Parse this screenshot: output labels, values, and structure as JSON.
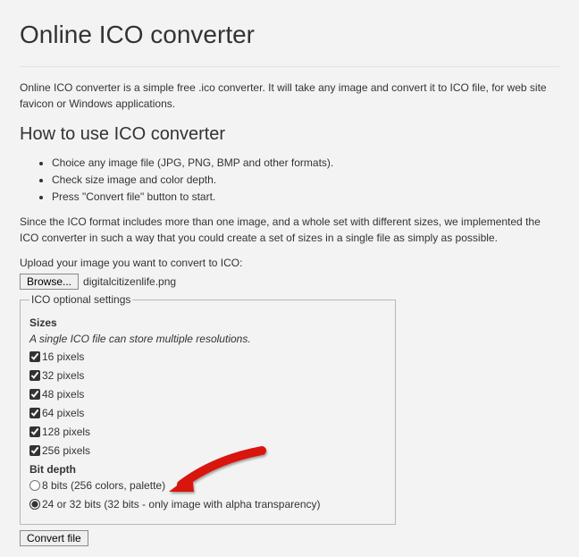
{
  "header": {
    "title": "Online ICO converter"
  },
  "intro": "Online ICO converter is a simple free .ico converter. It will take any image and convert it to ICO file, for web site favicon or Windows applications.",
  "howto": {
    "heading": "How to use ICO converter",
    "steps": [
      "Choice any image file (JPG, PNG, BMP and other formats).",
      "Check size image and color depth.",
      "Press \"Convert file\" button to start."
    ]
  },
  "description": "Since the ICO format includes more than one image, and a whole set with different sizes, we implemented the ICO converter in such a way that you could create a set of sizes in a single file as simply as possible.",
  "upload": {
    "label": "Upload your image you want to convert to ICO:",
    "browse_label": "Browse...",
    "file_name": "digitalcitizenlife.png"
  },
  "settings": {
    "legend": "ICO optional settings",
    "sizes": {
      "label": "Sizes",
      "sub": "A single ICO file can store multiple resolutions.",
      "options": [
        {
          "label": "16 pixels",
          "checked": true
        },
        {
          "label": "32 pixels",
          "checked": true
        },
        {
          "label": "48 pixels",
          "checked": true
        },
        {
          "label": "64 pixels",
          "checked": true
        },
        {
          "label": "128 pixels",
          "checked": true
        },
        {
          "label": "256 pixels",
          "checked": true
        }
      ]
    },
    "bitdepth": {
      "label": "Bit depth",
      "options": [
        {
          "label": "8 bits (256 colors, palette)",
          "checked": false
        },
        {
          "label": "24 or 32 bits (32 bits - only image with alpha transparency)",
          "checked": true
        }
      ]
    }
  },
  "convert": {
    "label": "Convert file"
  }
}
